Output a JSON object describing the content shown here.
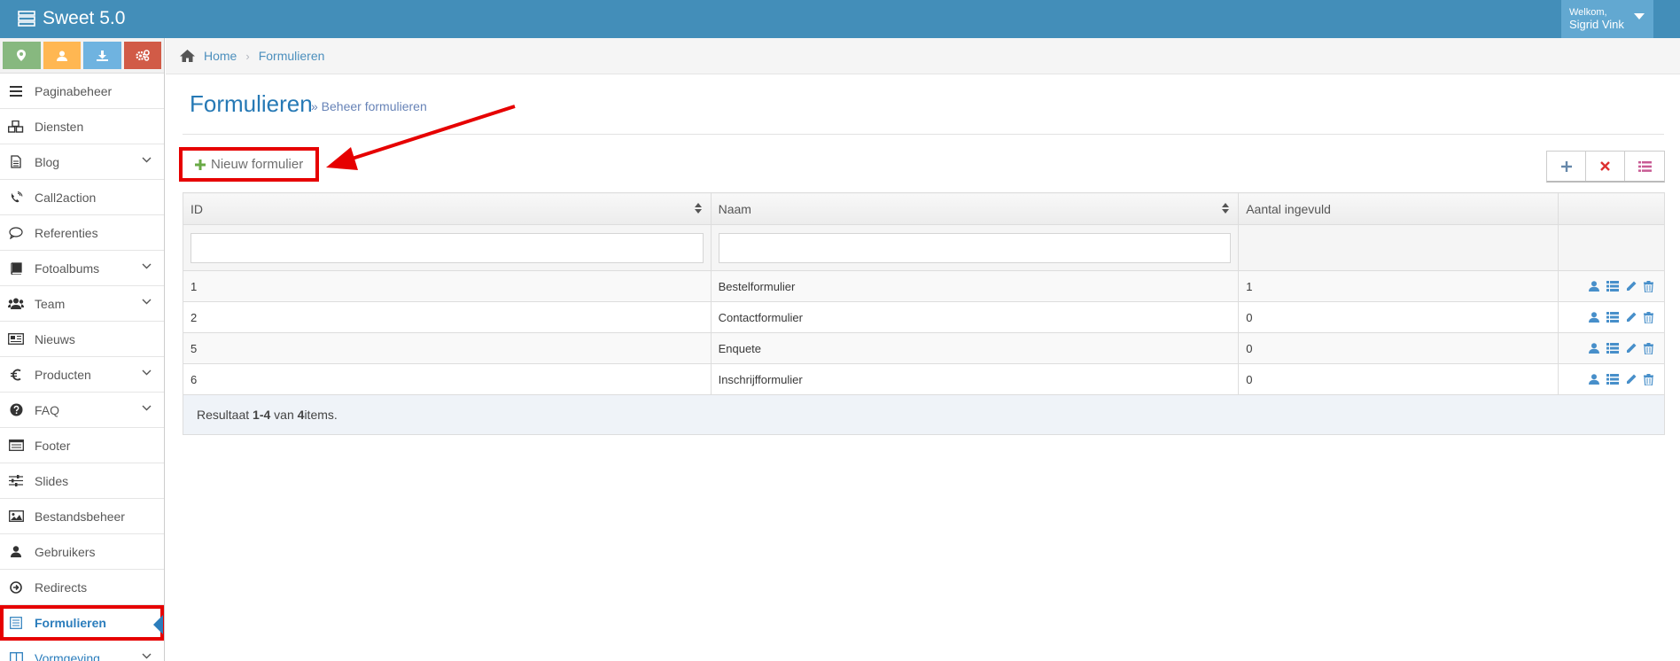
{
  "app": {
    "title": "Sweet 5.0"
  },
  "user": {
    "greeting": "Welkom,",
    "name": "Sigrid Vink"
  },
  "shortcuts": [
    {
      "icon": "map-marker-icon",
      "color": "#87b87f"
    },
    {
      "icon": "user-icon",
      "color": "#ffb752"
    },
    {
      "icon": "download-icon",
      "color": "#6fb3e0"
    },
    {
      "icon": "cogs-icon",
      "color": "#d15b47"
    }
  ],
  "sidebar": {
    "items": [
      {
        "label": "Paginabeheer",
        "icon": "bars-icon"
      },
      {
        "label": "Diensten",
        "icon": "cubes-icon"
      },
      {
        "label": "Blog",
        "icon": "file-icon",
        "has_children": true
      },
      {
        "label": "Call2action",
        "icon": "phone-icon"
      },
      {
        "label": "Referenties",
        "icon": "comment-icon"
      },
      {
        "label": "Fotoalbums",
        "icon": "book-icon",
        "has_children": true
      },
      {
        "label": "Team",
        "icon": "users-icon",
        "has_children": true
      },
      {
        "label": "Nieuws",
        "icon": "newspaper-icon"
      },
      {
        "label": "Producten",
        "icon": "euro-icon",
        "has_children": true
      },
      {
        "label": "FAQ",
        "icon": "question-icon",
        "has_children": true
      },
      {
        "label": "Footer",
        "icon": "list-alt-icon"
      },
      {
        "label": "Slides",
        "icon": "sliders-icon"
      },
      {
        "label": "Bestandsbeheer",
        "icon": "image-icon"
      },
      {
        "label": "Gebruikers",
        "icon": "user-icon"
      },
      {
        "label": "Redirects",
        "icon": "arrow-circle-icon"
      },
      {
        "label": "Formulieren",
        "icon": "form-icon",
        "active": true
      },
      {
        "label": "Vormgeving",
        "icon": "columns-icon",
        "has_children": true
      }
    ]
  },
  "breadcrumb": {
    "home": "Home",
    "current": "Formulieren"
  },
  "page": {
    "title": "Formulieren",
    "subtitle": "» Beheer formulieren"
  },
  "toolbar": {
    "new_label": "Nieuw formulier"
  },
  "table": {
    "headers": [
      "ID",
      "Naam",
      "Aantal ingevuld"
    ],
    "rows": [
      {
        "id": "1",
        "name": "Bestelformulier",
        "count": "1"
      },
      {
        "id": "2",
        "name": "Contactformulier",
        "count": "0"
      },
      {
        "id": "5",
        "name": "Enquete",
        "count": "0"
      },
      {
        "id": "6",
        "name": "Inschrijfformulier",
        "count": "0"
      }
    ],
    "summary": {
      "prefix": "Resultaat ",
      "range": "1-4",
      "middle": " van ",
      "total": "4",
      "suffix": " items."
    }
  },
  "colors": {
    "navbar": "#438eb9",
    "highlight": "#e60000",
    "accent": "#2b7dbc"
  }
}
